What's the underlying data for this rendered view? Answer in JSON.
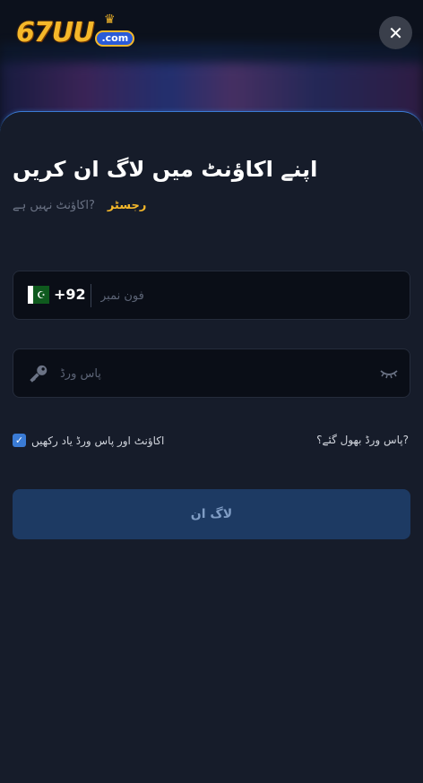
{
  "header": {
    "logo_text": "67UU",
    "logo_sub": ".com",
    "close_symbol": "✕"
  },
  "login": {
    "title": "اپنے اکاؤنٹ میں لاگ ان کریں",
    "no_account_text": "اکاؤنٹ نہیں ہے?",
    "register_link": "رجسٹر"
  },
  "phone": {
    "country_code": "+92",
    "placeholder": "فون نمبر",
    "flag_icon": "pakistan-flag-icon",
    "flag_symbol": "☪"
  },
  "password": {
    "placeholder": "پاس ورڈ",
    "icon": "key-icon",
    "toggle_icon": "eye-closed-icon"
  },
  "options": {
    "remember_label": "اکاؤنٹ اور پاس ورڈ یاد رکھیں",
    "remember_checked": true,
    "check_symbol": "✓",
    "forgot_link": "پاس ورڈ بھول گئے؟?"
  },
  "actions": {
    "login_button": "لاگ ان"
  },
  "colors": {
    "accent": "#3a7bd5",
    "brand_gold": "#f5b82a",
    "button_bg": "#1d3a63",
    "background": "#161c2a"
  }
}
